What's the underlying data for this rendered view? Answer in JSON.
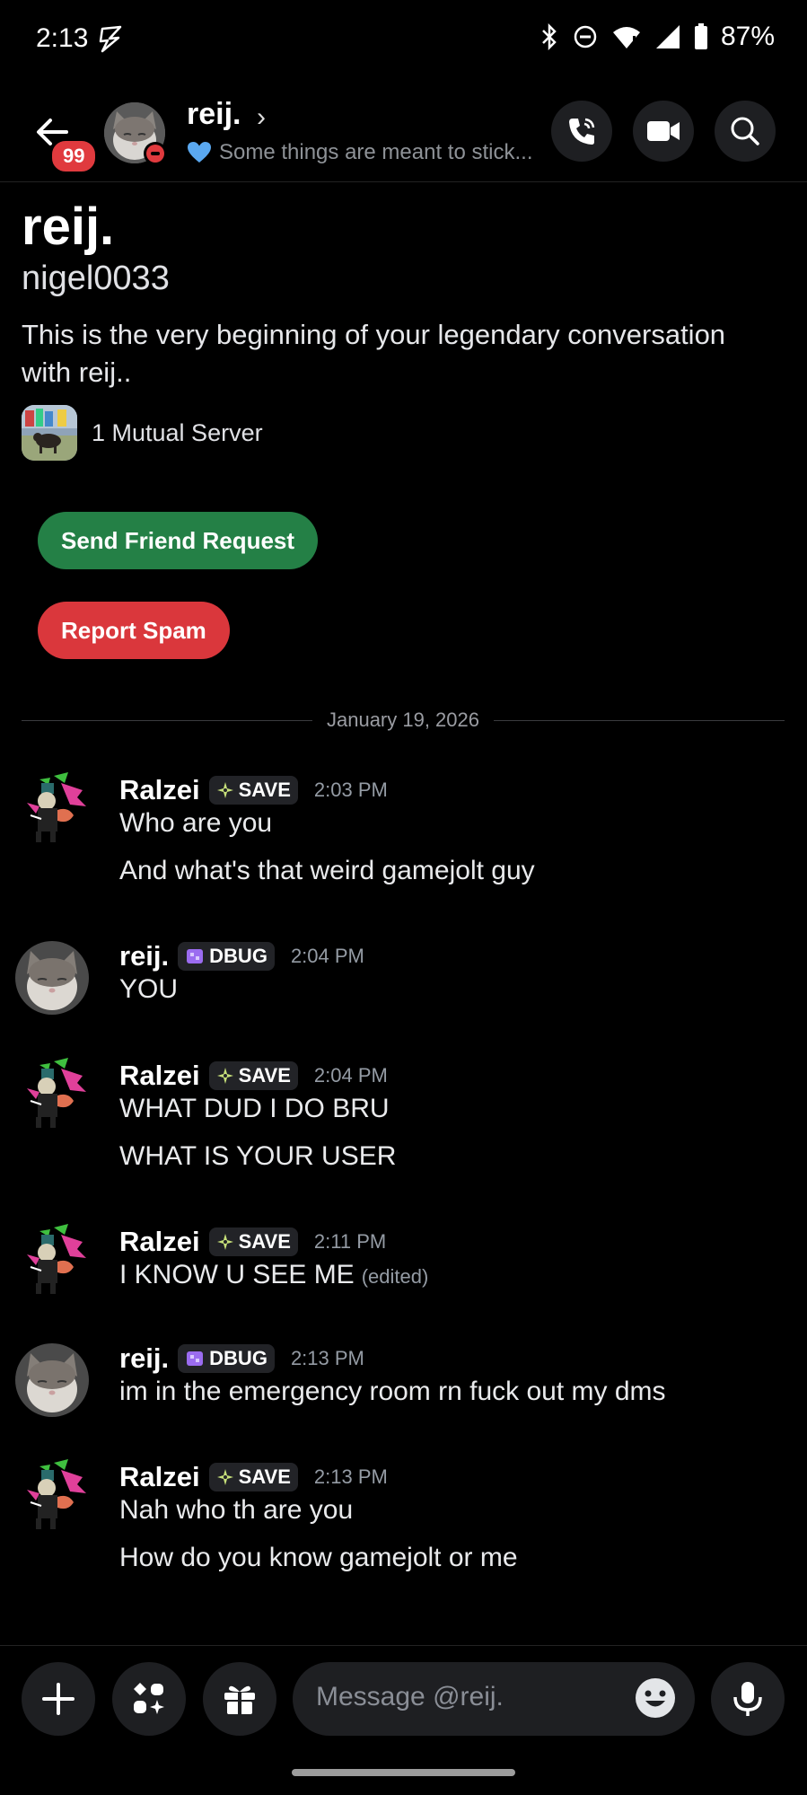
{
  "status_bar": {
    "time": "2:13",
    "battery": "87%"
  },
  "header": {
    "back_badge": "99",
    "name": "reij.",
    "chevron": "›",
    "status_text": "Some things are meant to stick...",
    "status_icon": "blue-heart-icon"
  },
  "profile": {
    "display_name": "reij.",
    "username": "nigel0033",
    "description": "This is the very beginning of your legendary conversation with reij..",
    "mutual_servers": "1 Mutual Server"
  },
  "actions": {
    "friend_request": "Send Friend Request",
    "report_spam": "Report Spam"
  },
  "divider_date": "January 19, 2026",
  "messages": [
    {
      "author": "Ralzei",
      "tag": "SAVE",
      "time": "2:03 PM",
      "lines": [
        "Who are you",
        "And what's that weird gamejolt guy"
      ]
    },
    {
      "author": "reij.",
      "tag": "DBUG",
      "time": "2:04 PM",
      "lines": [
        "YOU"
      ]
    },
    {
      "author": "Ralzei",
      "tag": "SAVE",
      "time": "2:04 PM",
      "lines": [
        "WHAT DUD I DO BRU",
        "WHAT IS YOUR USER"
      ]
    },
    {
      "author": "Ralzei",
      "tag": "SAVE",
      "time": "2:11 PM",
      "lines": [
        "I KNOW U SEE ME"
      ],
      "edited": "(edited)"
    },
    {
      "author": "reij.",
      "tag": "DBUG",
      "time": "2:13 PM",
      "lines": [
        "im in the emergency room rn fuck out my dms"
      ]
    },
    {
      "author": "Ralzei",
      "tag": "SAVE",
      "time": "2:13 PM",
      "lines": [
        "Nah who th are you",
        "How do you know gamejolt or me"
      ]
    }
  ],
  "composer": {
    "placeholder": "Message @reij."
  },
  "colors": {
    "background": "#000000",
    "green": "#248046",
    "red": "#da373c",
    "badge": "#e03a3e",
    "dbug": "#9b6cf0",
    "save": "#c7e07a"
  }
}
